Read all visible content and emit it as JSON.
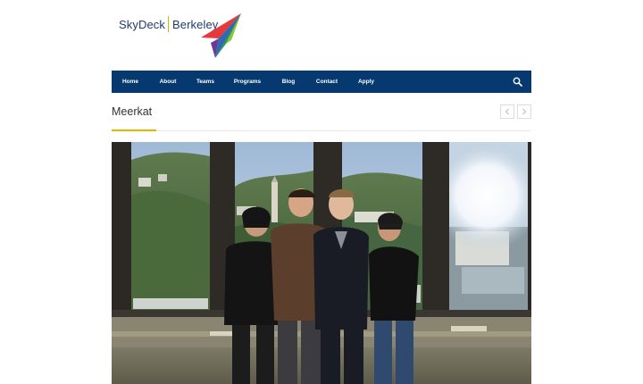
{
  "logo": {
    "brand_left": "SkyDeck",
    "brand_right": "Berkeley"
  },
  "nav": {
    "items": [
      {
        "label": "Home"
      },
      {
        "label": "About"
      },
      {
        "label": "Teams"
      },
      {
        "label": "Programs"
      },
      {
        "label": "Blog"
      },
      {
        "label": "Contact"
      },
      {
        "label": "Apply"
      }
    ],
    "search_icon": "search-icon"
  },
  "page": {
    "title": "Meerkat"
  },
  "pager": {
    "prev_icon": "chevron-left-icon",
    "next_icon": "chevron-right-icon"
  },
  "colors": {
    "nav_bg": "#063970",
    "accent": "#e8b400",
    "brand_text": "#1f3a6e"
  },
  "photo": {
    "subject": "team-photo"
  }
}
